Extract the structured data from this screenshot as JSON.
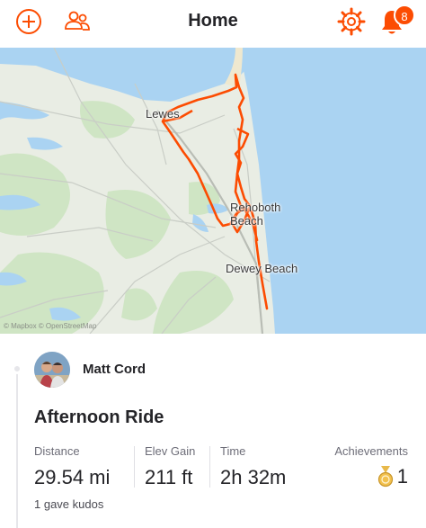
{
  "header": {
    "title": "Home",
    "notification_count": "8",
    "accent_color": "#fc4c02",
    "icons": [
      "add-icon",
      "people-icon",
      "gear-icon",
      "bell-icon"
    ]
  },
  "map": {
    "places": [
      "Lewes",
      "Rehoboth\nBeach",
      "Dewey Beach"
    ],
    "attribution": "© Mapbox © OpenStreetMap",
    "route_color": "#fc4c02",
    "water_color": "#aad3f2"
  },
  "activity": {
    "athlete_name": "Matt Cord",
    "title": "Afternoon Ride",
    "stats": [
      {
        "label": "Distance",
        "value": "29.54 mi"
      },
      {
        "label": "Elev Gain",
        "value": "211 ft"
      },
      {
        "label": "Time",
        "value": "2h 32m"
      }
    ],
    "achievements": {
      "label": "Achievements",
      "value": "1"
    },
    "kudos": "1 gave kudos"
  }
}
